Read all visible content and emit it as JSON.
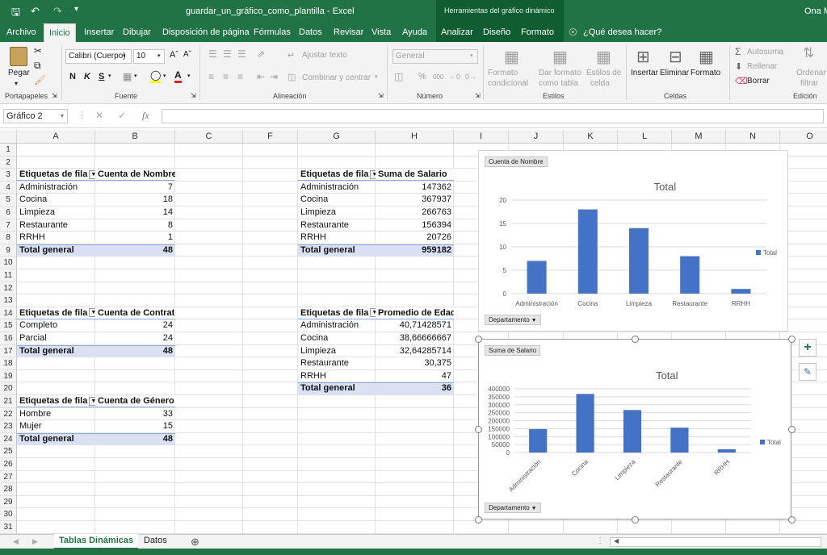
{
  "window": {
    "doc_title": "guardar_un_gráfico_como_plantilla  -  Excel",
    "context_title": "Herramientas del gráfico dinámico",
    "user": "Ona M"
  },
  "tabs": [
    {
      "label": "Archivo"
    },
    {
      "label": "Inicio"
    },
    {
      "label": "Insertar"
    },
    {
      "label": "Dibujar"
    },
    {
      "label": "Disposición de página"
    },
    {
      "label": "Fórmulas"
    },
    {
      "label": "Datos"
    },
    {
      "label": "Revisar"
    },
    {
      "label": "Vista"
    },
    {
      "label": "Ayuda"
    },
    {
      "label": "Analizar"
    },
    {
      "label": "Diseño"
    },
    {
      "label": "Formato"
    }
  ],
  "tell_me": "¿Qué desea hacer?",
  "ribbon": {
    "paste": "Pegar",
    "font_name": "Calibri (Cuerpo)",
    "font_size": "10",
    "bold": "N",
    "italic": "K",
    "underline": "S",
    "wrap_text": "Ajustar texto",
    "merge_center": "Combinar y centrar",
    "number_format": "General",
    "percent": "%",
    "thousands": "000",
    "cond_format": [
      "Formato",
      "condicional"
    ],
    "format_table": [
      "Dar formato",
      "como tabla"
    ],
    "cell_styles": [
      "Estilos de",
      "celda"
    ],
    "insert": "Insertar",
    "delete": "Eliminar",
    "format": "Formato",
    "autosum": "Autosuma",
    "fill": "Rellenar",
    "clear": "Borrar",
    "sort": [
      "Ordenar",
      "filtrar"
    ],
    "groups": {
      "clipboard": "Portapapeles",
      "font": "Fuente",
      "alignment": "Alineación",
      "number": "Número",
      "styles": "Estilos",
      "cells": "Celdas",
      "editing": "Edición"
    }
  },
  "formula_bar": {
    "name_box": "Gráfico 2",
    "fx": "fx",
    "value": ""
  },
  "columns": [
    "A",
    "B",
    "C",
    "F",
    "G",
    "H",
    "I",
    "J",
    "K",
    "L",
    "M",
    "N",
    "O"
  ],
  "rows": [
    "1",
    "2",
    "3",
    "4",
    "5",
    "6",
    "7",
    "8",
    "9",
    "10",
    "11",
    "12",
    "13",
    "14",
    "15",
    "16",
    "17",
    "18",
    "19",
    "20",
    "21",
    "22",
    "23",
    "24",
    "25",
    "26",
    "27",
    "28",
    "29",
    "30",
    "31"
  ],
  "pivots": {
    "nombre": {
      "header": [
        "Etiquetas de fila",
        "Cuenta de Nombre"
      ],
      "rows": [
        [
          "Administración",
          "7"
        ],
        [
          "Cocina",
          "18"
        ],
        [
          "Limpieza",
          "14"
        ],
        [
          "Restaurante",
          "8"
        ],
        [
          "RRHH",
          "1"
        ]
      ],
      "total": [
        "Total general",
        "48"
      ]
    },
    "contrato": {
      "header": [
        "Etiquetas de fila",
        "Cuenta de Contrato"
      ],
      "rows": [
        [
          "Completo",
          "24"
        ],
        [
          "Parcial",
          "24"
        ]
      ],
      "total": [
        "Total general",
        "48"
      ]
    },
    "genero": {
      "header": [
        "Etiquetas de fila",
        "Cuenta de Género"
      ],
      "rows": [
        [
          "Hombre",
          "33"
        ],
        [
          "Mujer",
          "15"
        ]
      ],
      "total": [
        "Total general",
        "48"
      ]
    },
    "salario": {
      "header": [
        "Etiquetas de fila",
        "Suma de Salario"
      ],
      "rows": [
        [
          "Administración",
          "147362"
        ],
        [
          "Cocina",
          "367937"
        ],
        [
          "Limpieza",
          "266763"
        ],
        [
          "Restaurante",
          "156394"
        ],
        [
          "RRHH",
          "20726"
        ]
      ],
      "total": [
        "Total general",
        "959182"
      ]
    },
    "edad": {
      "header": [
        "Etiquetas de fila",
        "Promedio de Edad"
      ],
      "rows": [
        [
          "Administración",
          "40,71428571"
        ],
        [
          "Cocina",
          "38,66666667"
        ],
        [
          "Limpieza",
          "32,64285714"
        ],
        [
          "Restaurante",
          "30,375"
        ],
        [
          "RRHH",
          "47"
        ]
      ],
      "total": [
        "Total general",
        "36"
      ]
    }
  },
  "chart_data": [
    {
      "type": "bar",
      "field_button": "Cuenta de Nombre",
      "axis_button": "Departamento",
      "title": "Total",
      "categories": [
        "Administración",
        "Cocina",
        "Limpieza",
        "Restaurante",
        "RRHH"
      ],
      "series": [
        {
          "name": "Total",
          "values": [
            7,
            18,
            14,
            8,
            1
          ]
        }
      ],
      "ylim": [
        0,
        20
      ],
      "yticks": [
        0,
        5,
        10,
        15,
        20
      ],
      "legend": "right",
      "grid": true,
      "color": "#4472c4"
    },
    {
      "type": "bar",
      "field_button": "Suma de Salario",
      "axis_button": "Departamento",
      "title": "Total",
      "categories": [
        "Administración",
        "Cocina",
        "Limpieza",
        "Restaurante",
        "RRHH"
      ],
      "series": [
        {
          "name": "Total",
          "values": [
            147362,
            367937,
            266763,
            156394,
            20726
          ]
        }
      ],
      "ylim": [
        0,
        400000
      ],
      "yticks": [
        0,
        50000,
        100000,
        150000,
        200000,
        250000,
        300000,
        350000,
        400000
      ],
      "legend": "right",
      "grid": true,
      "rotated_labels": true,
      "color": "#4472c4"
    }
  ],
  "sheets": [
    {
      "label": "Tablas Dinámicas"
    },
    {
      "label": "Datos"
    }
  ],
  "colors": {
    "excel_green": "#217346",
    "bar": "#4472c4",
    "pivot_total": "#d9e1f2"
  }
}
